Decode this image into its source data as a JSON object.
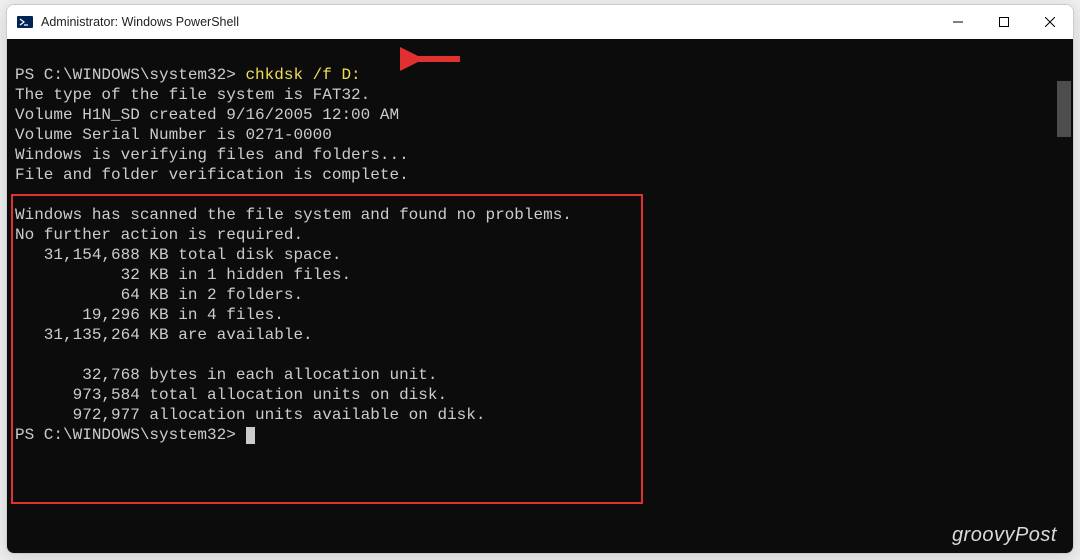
{
  "window": {
    "title": "Administrator: Windows PowerShell"
  },
  "terminal": {
    "prompt1_path": "PS C:\\WINDOWS\\system32> ",
    "command": "chkdsk /f D:",
    "lines": {
      "l1": "The type of the file system is FAT32.",
      "l2": "Volume H1N_SD created 9/16/2005 12:00 AM",
      "l3": "Volume Serial Number is 0271-0000",
      "l4": "Windows is verifying files and folders...",
      "l5": "File and folder verification is complete.",
      "blank1": "",
      "r1": "Windows has scanned the file system and found no problems.",
      "r2": "No further action is required.",
      "r3": "   31,154,688 KB total disk space.",
      "r4": "           32 KB in 1 hidden files.",
      "r5": "           64 KB in 2 folders.",
      "r6": "       19,296 KB in 4 files.",
      "r7": "   31,135,264 KB are available.",
      "blank2": "",
      "r8": "       32,768 bytes in each allocation unit.",
      "r9": "      973,584 total allocation units on disk.",
      "r10": "      972,977 allocation units available on disk."
    },
    "prompt2_path": "PS C:\\WINDOWS\\system32> "
  },
  "watermark": "groovyPost",
  "colors": {
    "terminal_bg": "#0c0c0c",
    "terminal_fg": "#cccccc",
    "command_fg": "#eedd55",
    "highlight_border": "#e03030",
    "arrow": "#e03030"
  }
}
